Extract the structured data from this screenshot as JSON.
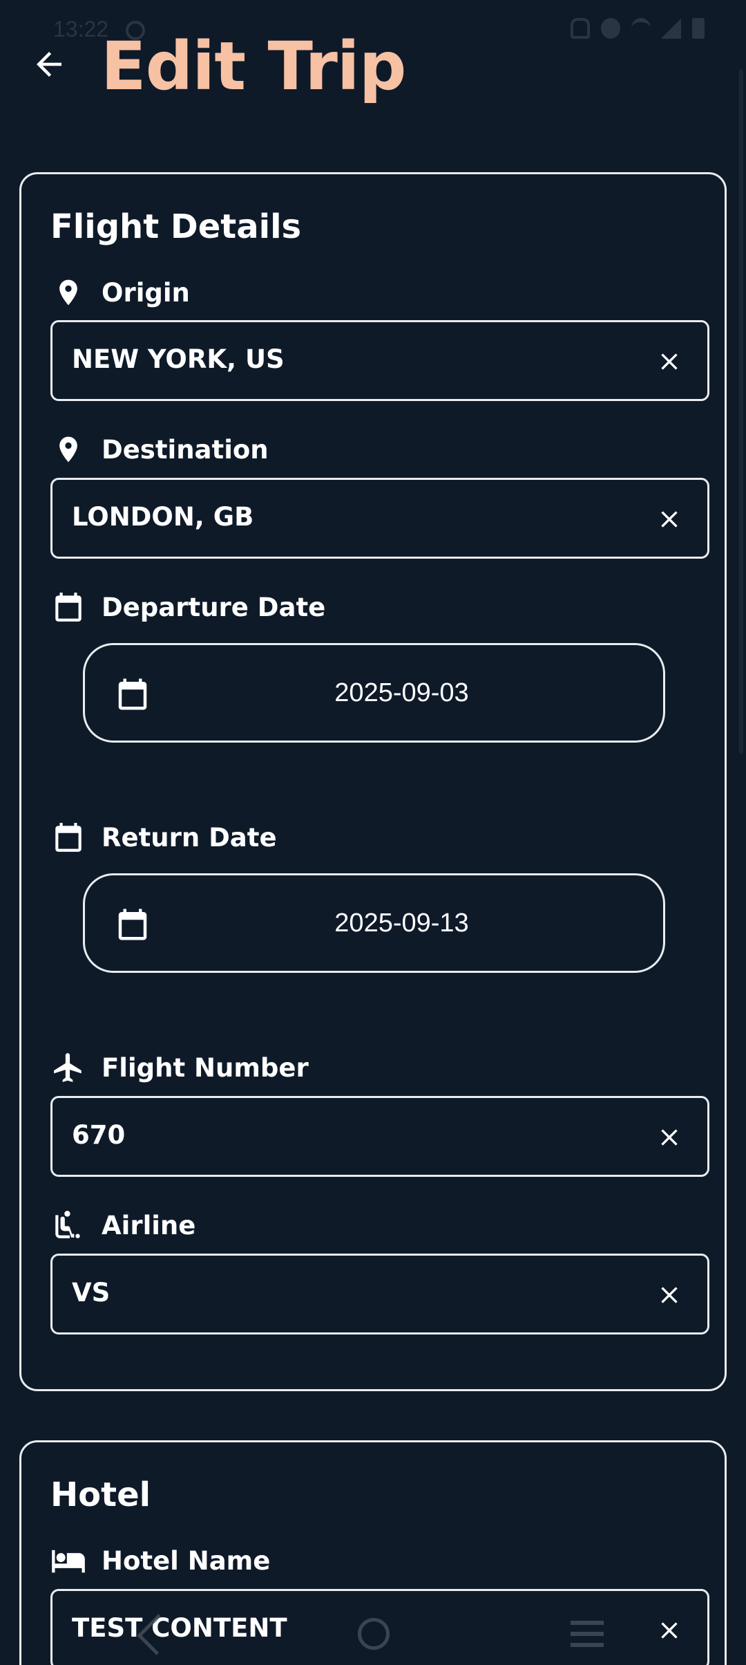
{
  "status_bar": {
    "time": "13:22"
  },
  "header": {
    "title": "Edit Trip"
  },
  "flight": {
    "section_title": "Flight Details",
    "origin": {
      "label": "Origin",
      "value": "NEW YORK, US"
    },
    "destination": {
      "label": "Destination",
      "value": "LONDON, GB"
    },
    "departure": {
      "label": "Departure Date",
      "value": "2025-09-03"
    },
    "return": {
      "label": "Return Date",
      "value": "2025-09-13"
    },
    "flight_number": {
      "label": "Flight Number",
      "value": "670"
    },
    "airline": {
      "label": "Airline",
      "value": "VS"
    }
  },
  "hotel": {
    "section_title": "Hotel",
    "name": {
      "label": "Hotel Name",
      "value": "TEST CONTENT"
    }
  },
  "icons": {
    "back": "arrow-left-icon",
    "origin": "location-pin-icon",
    "destination": "location-pin-icon",
    "date": "calendar-icon",
    "flight": "airplane-icon",
    "airline": "airline-seat-icon",
    "hotel": "bed-icon",
    "clear": "close-icon"
  },
  "colors": {
    "background": "#0f1a29",
    "title_accent": "#f7c1a3",
    "border": "#e9ecf0",
    "text": "#ffffff"
  }
}
